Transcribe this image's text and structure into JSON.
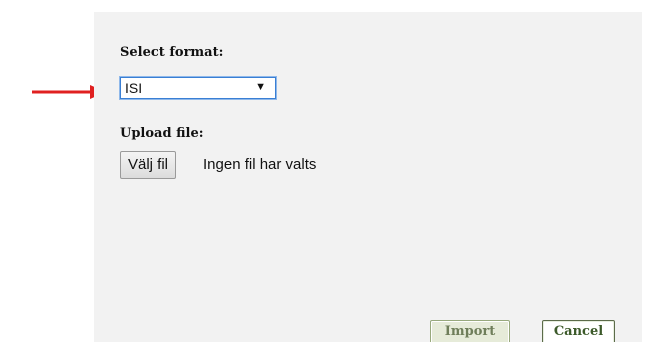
{
  "form": {
    "format_label": "Select format:",
    "format_selected": "ISI",
    "upload_label": "Upload file:",
    "file_button_label": "Välj fil",
    "file_status": "Ingen fil har valts"
  },
  "actions": {
    "import_label": "Import",
    "cancel_label": "Cancel"
  },
  "icons": {
    "select_caret": "▼",
    "annotation_arrow": "red-arrow-right"
  },
  "colors": {
    "panel_background": "#f2f2f2",
    "annotation_arrow": "#e02020",
    "focus_border": "#3a7fd4",
    "import_text": "#6f7e5a",
    "cancel_text": "#3c5a2a"
  }
}
